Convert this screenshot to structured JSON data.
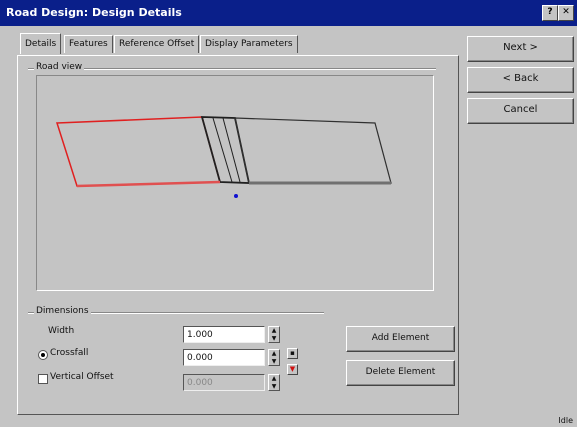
{
  "window": {
    "title": "Road Design: Design Details",
    "help_button": "?",
    "close_button": "✕"
  },
  "tabs": [
    {
      "label": "Details"
    },
    {
      "label": "Features"
    },
    {
      "label": "Reference Offset"
    },
    {
      "label": "Display Parameters"
    }
  ],
  "preview": {
    "group_label": "Road view"
  },
  "side_buttons": {
    "next": "Next >",
    "back": "< Back",
    "cancel": "Cancel"
  },
  "dimensions": {
    "group_label": "Dimensions",
    "width": {
      "label": "Width",
      "value": "1.000"
    },
    "crossfall": {
      "label": "Crossfall",
      "value": "0.000",
      "selected": true
    },
    "vertical_offset": {
      "label": "Vertical Offset",
      "value": "0.000",
      "checked": false
    }
  },
  "buttons": {
    "add_element": "Add Element",
    "delete_element": "Delete Element"
  },
  "status": {
    "text": "Idle"
  },
  "colors": {
    "title_bar": "#0a1f8a",
    "selected_outline": "#e02020",
    "point_marker": "#1010d0"
  }
}
